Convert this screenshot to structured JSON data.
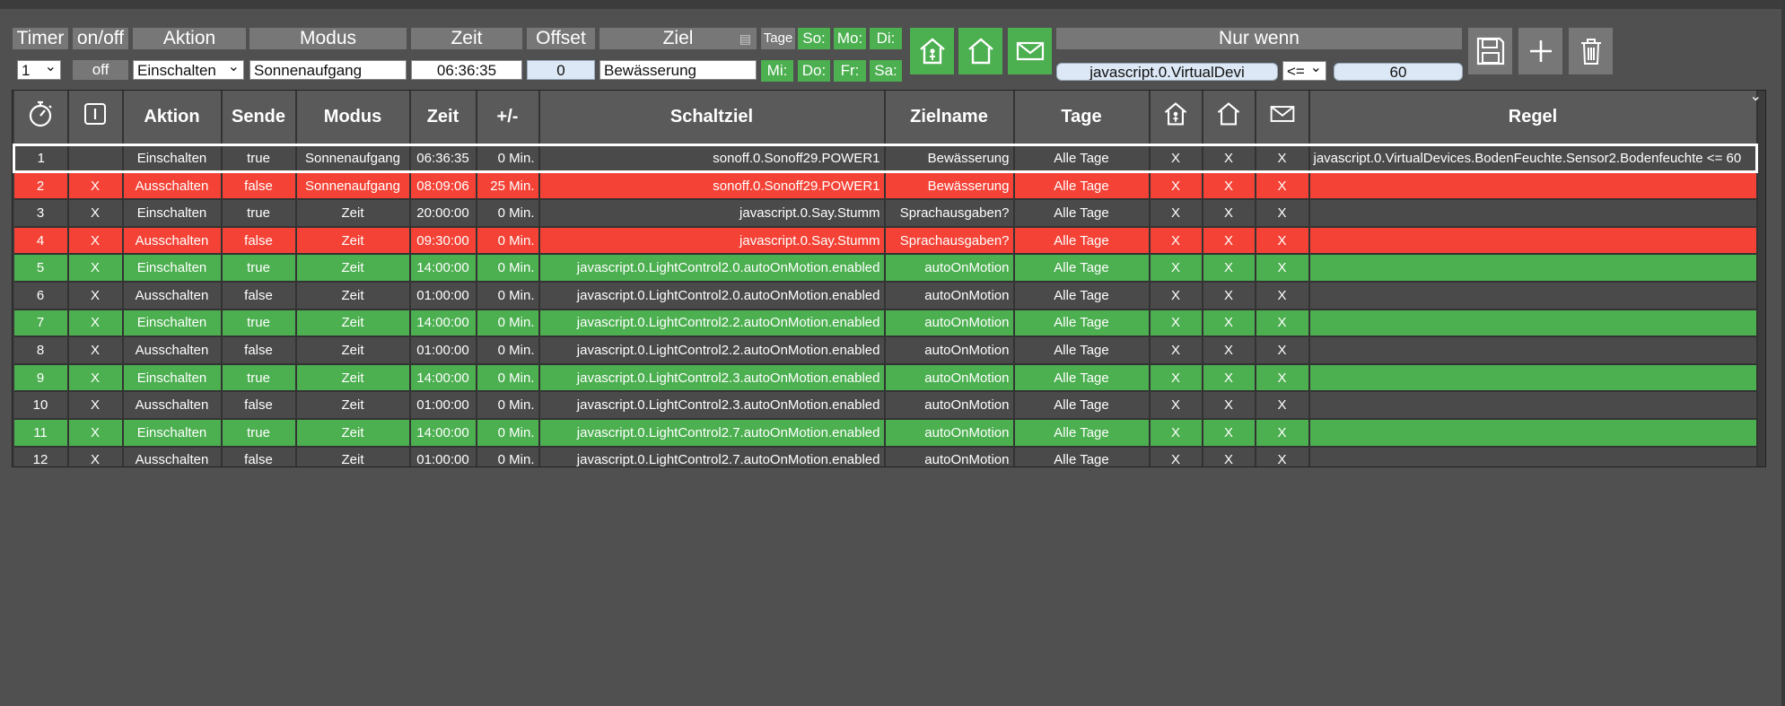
{
  "controls": {
    "headers": {
      "timer": "Timer",
      "onoff": "on/off",
      "aktion": "Aktion",
      "modus": "Modus",
      "zeit": "Zeit",
      "offset": "Offset",
      "ziel": "Ziel",
      "tage": "Tage",
      "nur_wenn": "Nur wenn"
    },
    "timer_value": "1",
    "onoff_value": "off",
    "aktion_value": "Einschalten",
    "modus_value": "Sonnenaufgang",
    "zeit_value": "06:36:35",
    "offset_value": "0",
    "ziel_value": "Bewässerung",
    "days_row1": [
      "So:",
      "Mo:",
      "Di:"
    ],
    "days_row2": [
      "Mi:",
      "Do:",
      "Fr:",
      "Sa:"
    ],
    "nur_wenn_value": "javascript.0.VirtualDevi",
    "operator_value": "<=",
    "compare_value": "60"
  },
  "table": {
    "columns": [
      "",
      "",
      "Aktion",
      "Sende",
      "Modus",
      "Zeit",
      "+/-",
      "Schaltziel",
      "Zielname",
      "Tage",
      "",
      "",
      "",
      "Regel"
    ],
    "rows": [
      {
        "style": "sel",
        "cells": [
          "1",
          "",
          "Einschalten",
          "true",
          "Sonnenaufgang",
          "06:36:35",
          "0 Min.",
          "sonoff.0.Sonoff29.POWER1",
          "Bewässerung",
          "Alle Tage",
          "X",
          "X",
          "X",
          "javascript.0.VirtualDevices.BodenFeuchte.Sensor2.Bodenfeuchte <= 60"
        ]
      },
      {
        "style": "red",
        "cells": [
          "2",
          "X",
          "Ausschalten",
          "false",
          "Sonnenaufgang",
          "08:09:06",
          "25 Min.",
          "sonoff.0.Sonoff29.POWER1",
          "Bewässerung",
          "Alle Tage",
          "X",
          "X",
          "X",
          ""
        ]
      },
      {
        "style": "dark",
        "cells": [
          "3",
          "X",
          "Einschalten",
          "true",
          "Zeit",
          "20:00:00",
          "0 Min.",
          "javascript.0.Say.Stumm",
          "Sprachausgaben?",
          "Alle Tage",
          "X",
          "X",
          "X",
          ""
        ]
      },
      {
        "style": "red",
        "cells": [
          "4",
          "X",
          "Ausschalten",
          "false",
          "Zeit",
          "09:30:00",
          "0 Min.",
          "javascript.0.Say.Stumm",
          "Sprachausgaben?",
          "Alle Tage",
          "X",
          "X",
          "X",
          ""
        ]
      },
      {
        "style": "green",
        "cells": [
          "5",
          "X",
          "Einschalten",
          "true",
          "Zeit",
          "14:00:00",
          "0 Min.",
          "javascript.0.LightControl2.0.autoOnMotion.enabled",
          "autoOnMotion",
          "Alle Tage",
          "X",
          "X",
          "X",
          ""
        ]
      },
      {
        "style": "dark",
        "cells": [
          "6",
          "X",
          "Ausschalten",
          "false",
          "Zeit",
          "01:00:00",
          "0 Min.",
          "javascript.0.LightControl2.0.autoOnMotion.enabled",
          "autoOnMotion",
          "Alle Tage",
          "X",
          "X",
          "X",
          ""
        ]
      },
      {
        "style": "green",
        "cells": [
          "7",
          "X",
          "Einschalten",
          "true",
          "Zeit",
          "14:00:00",
          "0 Min.",
          "javascript.0.LightControl2.2.autoOnMotion.enabled",
          "autoOnMotion",
          "Alle Tage",
          "X",
          "X",
          "X",
          ""
        ]
      },
      {
        "style": "dark",
        "cells": [
          "8",
          "X",
          "Ausschalten",
          "false",
          "Zeit",
          "01:00:00",
          "0 Min.",
          "javascript.0.LightControl2.2.autoOnMotion.enabled",
          "autoOnMotion",
          "Alle Tage",
          "X",
          "X",
          "X",
          ""
        ]
      },
      {
        "style": "green",
        "cells": [
          "9",
          "X",
          "Einschalten",
          "true",
          "Zeit",
          "14:00:00",
          "0 Min.",
          "javascript.0.LightControl2.3.autoOnMotion.enabled",
          "autoOnMotion",
          "Alle Tage",
          "X",
          "X",
          "X",
          ""
        ]
      },
      {
        "style": "dark",
        "cells": [
          "10",
          "X",
          "Ausschalten",
          "false",
          "Zeit",
          "01:00:00",
          "0 Min.",
          "javascript.0.LightControl2.3.autoOnMotion.enabled",
          "autoOnMotion",
          "Alle Tage",
          "X",
          "X",
          "X",
          ""
        ]
      },
      {
        "style": "green",
        "cells": [
          "11",
          "X",
          "Einschalten",
          "true",
          "Zeit",
          "14:00:00",
          "0 Min.",
          "javascript.0.LightControl2.7.autoOnMotion.enabled",
          "autoOnMotion",
          "Alle Tage",
          "X",
          "X",
          "X",
          ""
        ]
      },
      {
        "style": "dark",
        "cells": [
          "12",
          "X",
          "Ausschalten",
          "false",
          "Zeit",
          "01:00:00",
          "0 Min.",
          "javascript.0.LightControl2.7.autoOnMotion.enabled",
          "autoOnMotion",
          "Alle Tage",
          "X",
          "X",
          "X",
          ""
        ]
      }
    ]
  },
  "colors": {
    "green": "#4caf50",
    "red": "#f44336",
    "grey": "#777777"
  }
}
